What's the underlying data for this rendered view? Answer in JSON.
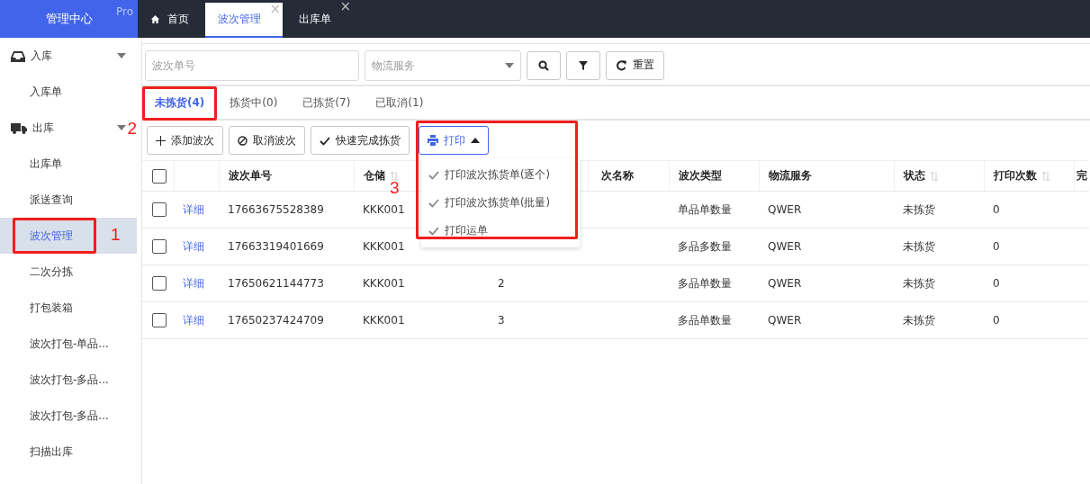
{
  "brand": {
    "title": "管理中心",
    "badge": "Pro"
  },
  "top_tabs": [
    {
      "label": "首页",
      "selected": false,
      "closable": false
    },
    {
      "label": "波次管理",
      "selected": true,
      "closable": true,
      "close": "×"
    },
    {
      "label": "出库单",
      "selected": false,
      "closable": true,
      "close": "×"
    }
  ],
  "sidebar": {
    "items": [
      {
        "kind": "group",
        "label": "入库",
        "expanded": true,
        "children": [
          {
            "label": "入库单",
            "selected": false
          }
        ]
      },
      {
        "kind": "group",
        "label": "出库",
        "expanded": true,
        "annotation": "2",
        "children": [
          {
            "label": "出库单",
            "selected": false
          },
          {
            "label": "派送查询",
            "selected": false
          },
          {
            "label": "波次管理",
            "selected": true,
            "highlighted": true,
            "annotation": "1"
          },
          {
            "label": "二次分拣",
            "selected": false
          },
          {
            "label": "打包装箱",
            "selected": false
          },
          {
            "label": "波次打包-单品...",
            "selected": false
          },
          {
            "label": "波次打包-多品...",
            "selected": false
          },
          {
            "label": "波次打包-多品...",
            "selected": false
          },
          {
            "label": "扫描出库",
            "selected": false
          }
        ]
      }
    ]
  },
  "filters": {
    "wave_no": {
      "placeholder": "波次单号"
    },
    "logistics": {
      "placeholder": "物流服务"
    },
    "reset": "重置"
  },
  "status_tabs": [
    {
      "label": "未拣货(4)",
      "selected": true,
      "highlighted": true
    },
    {
      "label": "拣货中(0)",
      "selected": false
    },
    {
      "label": "已拣货(7)",
      "selected": false
    },
    {
      "label": "已取消(1)",
      "selected": false
    }
  ],
  "actions": [
    {
      "kind": "plus",
      "label": "添加波次"
    },
    {
      "kind": "cancel",
      "label": "取消波次"
    },
    {
      "kind": "check",
      "label": "快速完成拣货"
    },
    {
      "kind": "print",
      "label": "打印",
      "highlighted": true,
      "annotation": "3",
      "expanded": true
    }
  ],
  "print_menu": [
    {
      "label": "打印波次拣货单(逐个)"
    },
    {
      "label": "打印波次拣货单(批量)"
    },
    {
      "label": "打印运单"
    }
  ],
  "table": {
    "select_all": {
      "checked": false
    },
    "columns": [
      {
        "label": "波次单号",
        "sortable": false
      },
      {
        "label": "仓储",
        "sortable": true
      },
      {},
      {
        "label": "次名称",
        "sortable": false
      },
      {
        "label": "波次类型",
        "sortable": false
      },
      {
        "label": "物流服务",
        "sortable": false
      },
      {
        "label": "状态",
        "sortable": true
      },
      {
        "label": "打印次数",
        "sortable": true
      },
      {
        "label": "完",
        "sortable": false
      }
    ],
    "rows": [
      {
        "checked": false,
        "link": "详细",
        "wave_no": "17663675528389",
        "warehouse": "KKK001",
        "wave_type": "单品单数量",
        "logistics": "QWER",
        "status": "未拣货",
        "print_count": "0"
      },
      {
        "checked": false,
        "link": "详细",
        "wave_no": "17663319401669",
        "warehouse": "KKK001",
        "wave_type": "多品多数量",
        "logistics": "QWER",
        "status": "未拣货",
        "print_count": "0"
      },
      {
        "checked": false,
        "link": "详细",
        "wave_no": "17650621144773",
        "warehouse": "KKK001",
        "column_3": "2",
        "wave_type": "多品单数量",
        "logistics": "QWER",
        "status": "未拣货",
        "print_count": "0"
      },
      {
        "checked": false,
        "link": "详细",
        "wave_no": "17650237424709",
        "warehouse": "KKK001",
        "column_3": "3",
        "wave_type": "多品单数量",
        "logistics": "QWER",
        "status": "未拣货",
        "print_count": "0"
      }
    ]
  }
}
